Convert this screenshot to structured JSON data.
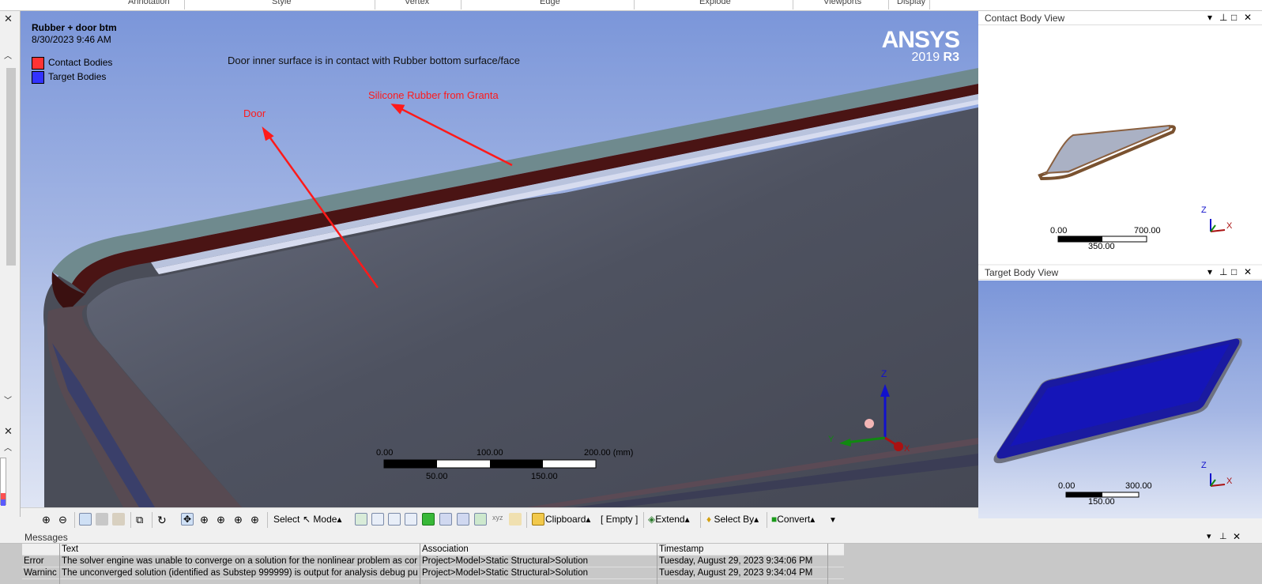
{
  "ribbon": {
    "groups": [
      "Annotation",
      "Style",
      "Vertex",
      "Edge",
      "Explode",
      "Viewports",
      "Display"
    ]
  },
  "viewport": {
    "title": "Rubber + door btm",
    "date": "8/30/2023 9:46 AM",
    "legend": [
      {
        "label": "Contact Bodies",
        "color": "#ff3333"
      },
      {
        "label": "Target Bodies",
        "color": "#3333ff"
      }
    ],
    "note": "Door inner surface is in contact with Rubber bottom surface/face",
    "annotation_door": "Door",
    "annotation_rubber": "Silicone Rubber from Granta",
    "logo_brand": "ANSYS",
    "logo_year": "2019",
    "logo_release": "R3",
    "scale": {
      "t0": "0.00",
      "t1": "100.00",
      "t2": "200.00 (mm)",
      "b1": "50.00",
      "b2": "150.00"
    },
    "triad": {
      "z": "Z",
      "y": "Y",
      "x": "X"
    }
  },
  "toolbar": {
    "select_label": "Select",
    "mode_label": "Mode",
    "clipboard_label": "Clipboard",
    "empty_label": "[ Empty ]",
    "extend_label": "Extend",
    "selectby_label": "Select By",
    "convert_label": "Convert"
  },
  "contact_view": {
    "title": "Contact Body View",
    "scale": {
      "t0": "0.00",
      "t1": "700.00",
      "b1": "350.00"
    },
    "triad": {
      "z": "Z",
      "x": "X"
    }
  },
  "target_view": {
    "title": "Target Body View",
    "scale": {
      "t0": "0.00",
      "t1": "300.00",
      "b1": "150.00"
    },
    "triad": {
      "z": "Z",
      "x": "X"
    }
  },
  "messages": {
    "title": "Messages",
    "columns": [
      "Text",
      "Association",
      "Timestamp"
    ],
    "rows": [
      {
        "type": "Error",
        "text": "The solver engine was unable to converge on a solution for the nonlinear problem as cor",
        "assoc": "Project>Model>Static Structural>Solution",
        "time": "Tuesday, August 29, 2023 9:34:06 PM"
      },
      {
        "type": "Warninc",
        "text": "The unconverged solution (identified as Substep 999999) is output for analysis debug pu",
        "assoc": "Project>Model>Static Structural>Solution",
        "time": "Tuesday, August 29, 2023 9:34:04 PM"
      }
    ]
  }
}
